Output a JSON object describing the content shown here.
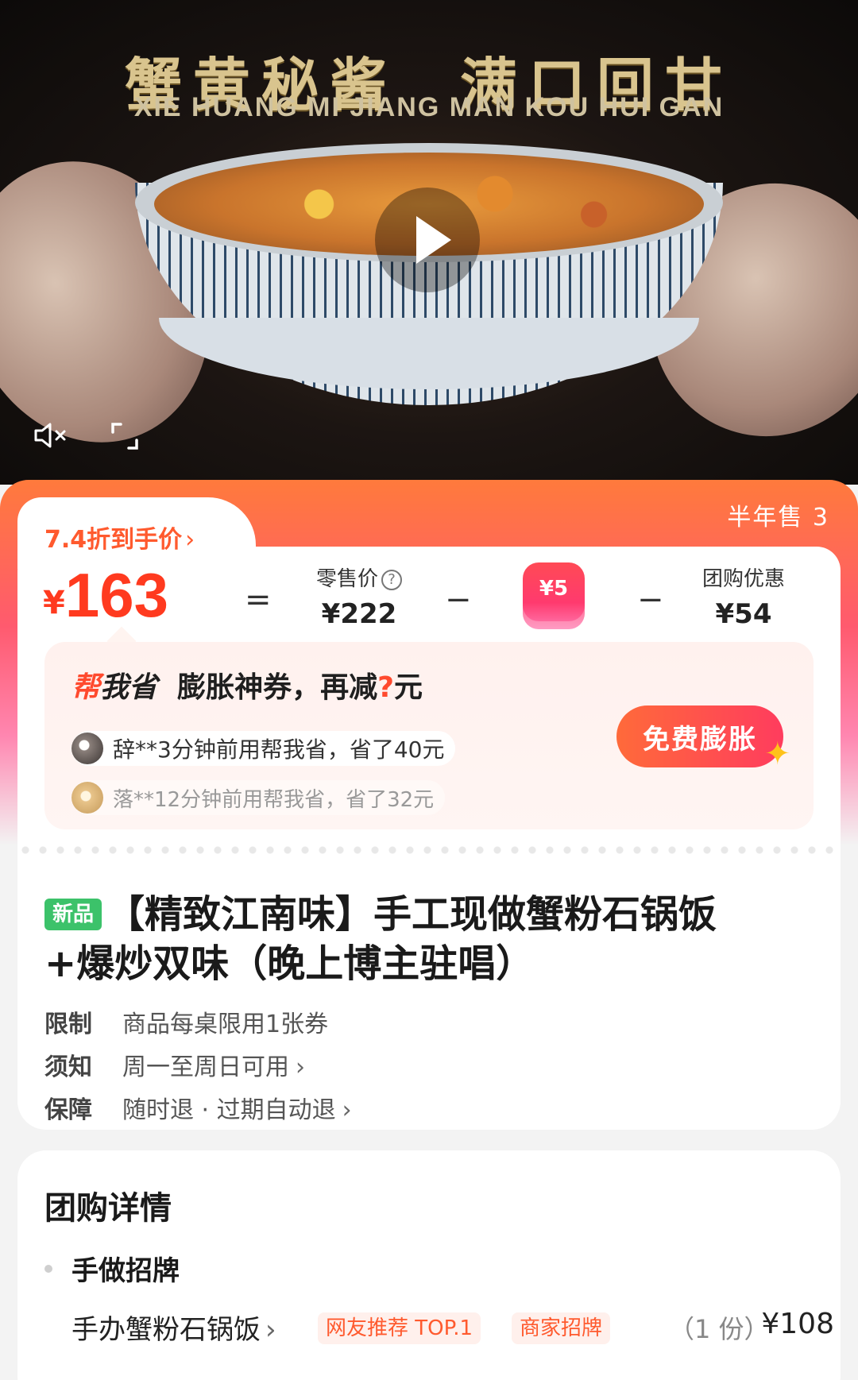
{
  "hero": {
    "title": "蟹黄秘酱  满口回甘",
    "subtitle": "XIE HUANG MI JIANG MAN KOU HUI GAN"
  },
  "price": {
    "sold": "半年售 3",
    "discount_tag": "7.4折到手价",
    "currency": "¥",
    "final": "163",
    "eq": "=",
    "minus": "−",
    "retail_label": "零售价",
    "retail_value": "¥222",
    "coupon_value": "¥5",
    "group_label": "团购优惠",
    "group_value": "¥54"
  },
  "save": {
    "brand_a": "帮",
    "brand_b": "我省",
    "text_a": "膨胀神券，再减",
    "q": "?",
    "text_b": "元",
    "row1": "辞**3分钟前用帮我省，省了40元",
    "row2": "落**12分钟前用帮我省，省了32元",
    "button": "免费膨胀"
  },
  "product": {
    "badge": "新品",
    "title": "【精致江南味】手工现做蟹粉石锅饭+爆炒双味（晚上博主驻唱）",
    "limit_key": "限制",
    "limit_val": "商品每桌限用1张券",
    "notice_key": "须知",
    "notice_val": "周一至周日可用",
    "guarantee_key": "保障",
    "guarantee_val": "随时退 · 过期自动退"
  },
  "details": {
    "title": "团购详情",
    "section": "手做招牌",
    "item": "手办蟹粉石锅饭",
    "tag1": "网友推荐 TOP.1",
    "tag2": "商家招牌",
    "qty": "（1 份）",
    "price": "¥108"
  },
  "icons": {
    "mute": "mute-icon",
    "fullscreen": "fullscreen-icon",
    "play": "play-icon",
    "help": "help-icon",
    "chevron": "chevron-right-icon"
  },
  "colors": {
    "accent": "#ff3a1f",
    "gradient_start": "#ff7a3c",
    "gradient_end": "#ff86b0",
    "new_badge": "#3cc26a"
  }
}
